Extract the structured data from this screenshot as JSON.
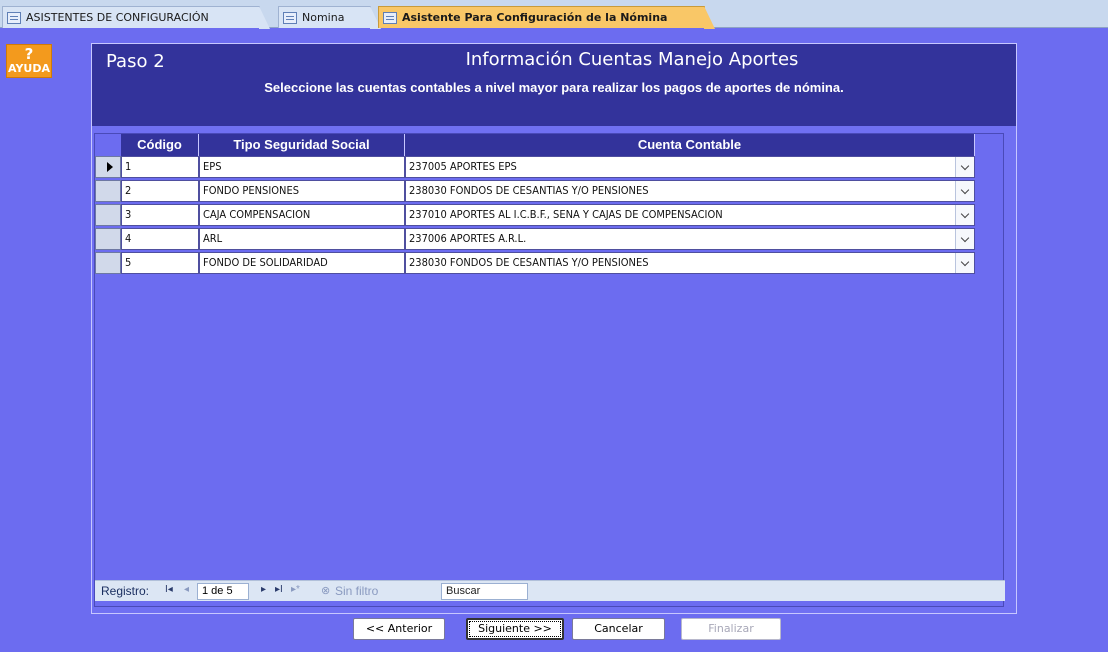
{
  "tabs": [
    {
      "label": "ASISTENTES DE CONFIGURACIÓN",
      "active": false
    },
    {
      "label": "Nomina",
      "active": false
    },
    {
      "label": "Asistente Para Configuración de la Nómina",
      "active": true
    }
  ],
  "help": {
    "symbol": "?",
    "label": "AYUDA"
  },
  "form": {
    "step": "Paso 2",
    "title": "Información Cuentas Manejo Aportes",
    "subtitle": "Seleccione las cuentas contables a nivel mayor para realizar los pagos de aportes de nómina."
  },
  "table": {
    "columns": [
      "Código",
      "Tipo Seguridad Social",
      "Cuenta Contable"
    ],
    "rows": [
      {
        "code": "1",
        "type": "EPS",
        "account": "237005 APORTES EPS"
      },
      {
        "code": "2",
        "type": "FONDO PENSIONES",
        "account": "238030 FONDOS DE CESANTIAS Y/O PENSIONES"
      },
      {
        "code": "3",
        "type": "CAJA COMPENSACION",
        "account": "237010 APORTES AL I.C.B.F., SENA Y CAJAS DE COMPENSACION"
      },
      {
        "code": "4",
        "type": "ARL",
        "account": "237006 APORTES  A.R.L."
      },
      {
        "code": "5",
        "type": "FONDO DE SOLIDARIDAD",
        "account": "238030 FONDOS DE CESANTIAS Y/O PENSIONES"
      }
    ]
  },
  "navigation": {
    "label": "Registro:",
    "first": "I◂",
    "prev": "◂",
    "position": "1 de 5",
    "next": "▸",
    "last": "▸I",
    "new": "▸*",
    "filter": "Sin filtro",
    "search": "Buscar"
  },
  "buttons": {
    "previous": "<< Anterior",
    "next": "Siguiente >>",
    "cancel": "Cancelar",
    "finish": "Finalizar"
  },
  "colors": {
    "background": "#6c6cf0",
    "header": "#33339b",
    "active_tab": "#f9c767",
    "help": "#f39a1d"
  }
}
